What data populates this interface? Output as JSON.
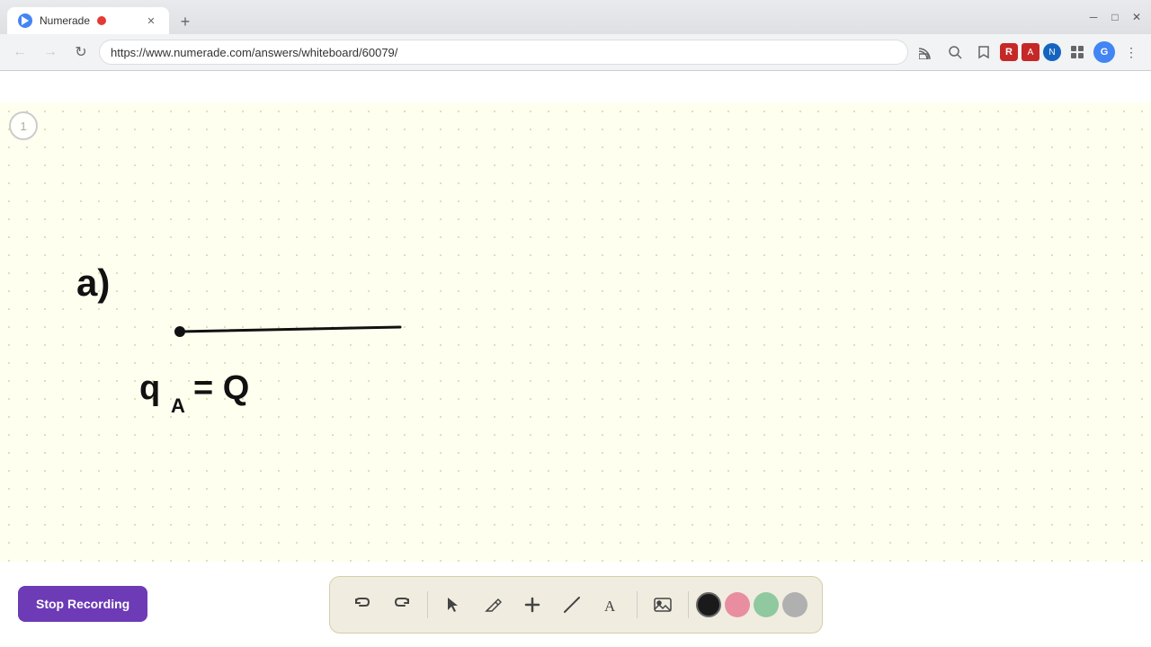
{
  "browser": {
    "tab_label": "Numerade",
    "tab_favicon": "N",
    "url": "https://www.numerade.com/answers/whiteboard/60079/",
    "new_tab_symbol": "+",
    "nav": {
      "back": "←",
      "forward": "→",
      "refresh": "↻"
    }
  },
  "toolbar": {
    "undo_label": "↩",
    "redo_label": "↪",
    "cursor_label": "↖",
    "pencil_label": "✏",
    "plus_label": "+",
    "eraser_label": "/",
    "text_label": "A",
    "image_label": "🖼",
    "colors": [
      {
        "name": "black",
        "hex": "#1a1a1a"
      },
      {
        "name": "pink",
        "hex": "#e88ea0"
      },
      {
        "name": "green",
        "hex": "#90c8a0"
      },
      {
        "name": "gray",
        "hex": "#b0b0b0"
      }
    ]
  },
  "page": {
    "number": "1"
  },
  "stop_recording": {
    "label": "Stop Recording"
  },
  "whiteboard": {
    "background": "#fffff0"
  }
}
